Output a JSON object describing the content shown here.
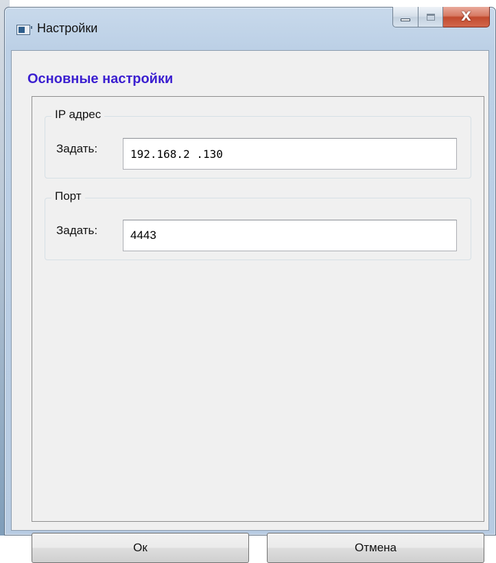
{
  "window": {
    "title": "Настройки",
    "close_glyph": "X",
    "icons": {
      "app": "app-window-icon",
      "minimize": "minimize-icon",
      "maximize": "maximize-icon",
      "close": "close-icon"
    }
  },
  "dialog": {
    "section_title": "Основные настройки",
    "section_title_color": "#3b1fd0",
    "ip_group": {
      "title": "IP адрес",
      "label": "Задать:",
      "value": "192.168.2 .130"
    },
    "port_group": {
      "title": "Порт",
      "label": "Задать:",
      "value": "4443"
    },
    "buttons": {
      "ok": "Ок",
      "cancel": "Отмена"
    }
  }
}
